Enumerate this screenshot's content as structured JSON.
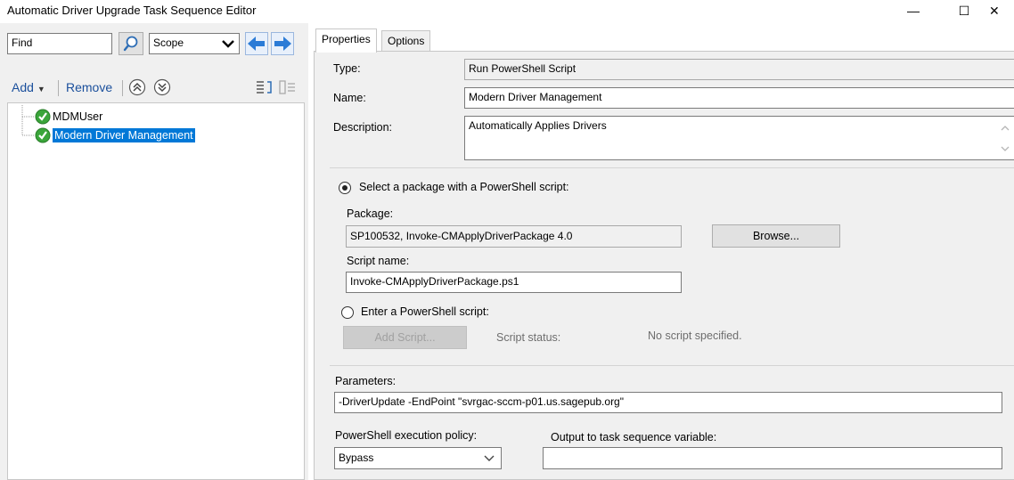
{
  "window": {
    "title": "Automatic Driver Upgrade Task Sequence Editor",
    "minimize_glyph": "—",
    "maximize_glyph": "☐",
    "close_glyph": "✕"
  },
  "left": {
    "find_value": "Find",
    "scope_value": "Scope",
    "toolbar": {
      "add_label": "Add",
      "remove_label": "Remove"
    },
    "tree": [
      {
        "label": "MDMUser",
        "icon": "check-icon"
      },
      {
        "label": "Modern Driver Management",
        "icon": "check-icon",
        "selected": true
      }
    ]
  },
  "tabs": [
    {
      "label": "Properties",
      "active": true
    },
    {
      "label": "Options",
      "active": false
    }
  ],
  "properties": {
    "type_label": "Type:",
    "type_value": "Run PowerShell Script",
    "name_label": "Name:",
    "name_value": "Modern Driver Management",
    "description_label": "Description:",
    "description_value": "Automatically Applies Drivers",
    "radio_package_label": "Select a package with a PowerShell script:",
    "package_label": "Package:",
    "package_value": "SP100532, Invoke-CMApplyDriverPackage 4.0",
    "browse_label": "Browse...",
    "script_name_label": "Script name:",
    "script_name_value": "Invoke-CMApplyDriverPackage.ps1",
    "radio_enter_label": "Enter a PowerShell script:",
    "add_script_label": "Add Script...",
    "script_status_label": "Script status:",
    "script_status_value": "No script specified.",
    "parameters_label": "Parameters:",
    "parameters_value": "-DriverUpdate -EndPoint \"svrgac-sccm-p01.us.sagepub.org\"",
    "policy_label": "PowerShell execution policy:",
    "policy_value": "Bypass",
    "output_var_label": "Output to task sequence variable:",
    "output_var_value": ""
  },
  "colors": {
    "selection": "#0078d7",
    "panel": "#f0f0f0",
    "check": "#3aa53a",
    "nav_arrow": "#2b7bd6"
  }
}
